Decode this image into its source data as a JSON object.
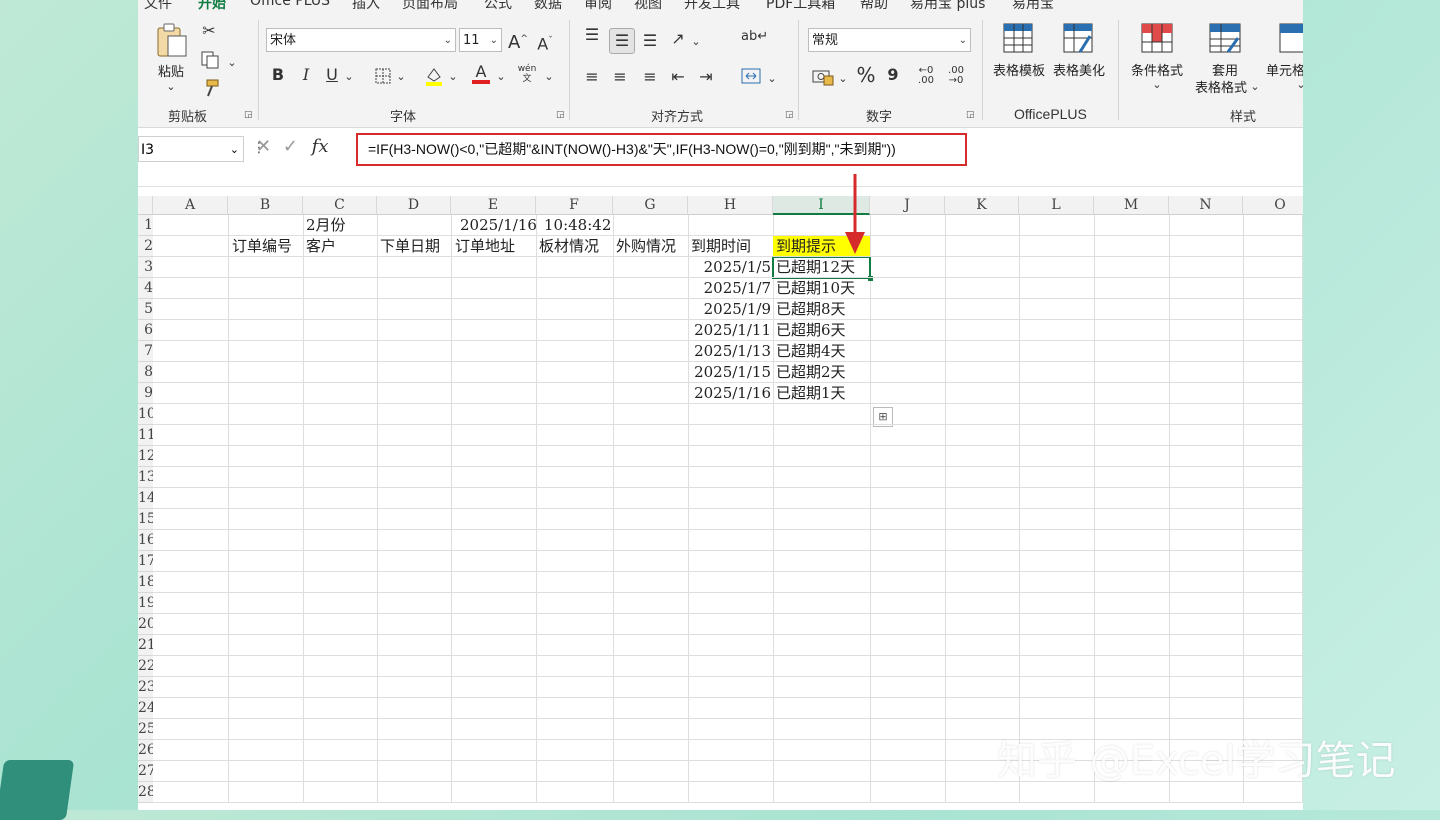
{
  "menu": {
    "items": [
      "文件",
      "开始",
      "Office PLUS",
      "插入",
      "页面布局",
      "公式",
      "数据",
      "审阅",
      "视图",
      "开发工具",
      "PDF工具箱",
      "帮助",
      "易用宝 plus",
      "易用宝"
    ],
    "active_index": 1
  },
  "ribbon": {
    "clipboard": {
      "label": "剪贴板",
      "paste_label": "粘贴"
    },
    "font": {
      "label": "字体",
      "font_name": "宋体",
      "font_size": "11",
      "bold": "B",
      "italic": "I",
      "underline": "U",
      "phonetic": "wén"
    },
    "alignment": {
      "label": "对齐方式"
    },
    "number": {
      "label": "数字",
      "format": "常规",
      "percent": "%",
      "comma": "9",
      "inc_decimal": ".00",
      "dec_decimal": ".00"
    },
    "officeplus": {
      "label": "OfficePLUS",
      "table_template": "表格模板",
      "table_beautify": "表格美化"
    },
    "styles": {
      "label": "样式",
      "conditional": "条件格式",
      "format_table_1": "套用",
      "format_table_2": "表格格式",
      "cell_styles": "单元格"
    }
  },
  "formula_bar": {
    "name_box": "I3",
    "fx": "fx",
    "formula": "=IF(H3-NOW()<0,\"已超期\"&INT(NOW()-H3)&\"天\",IF(H3-NOW()=0,\"刚到期\",\"未到期\"))"
  },
  "sheet": {
    "columns": [
      "A",
      "B",
      "C",
      "D",
      "E",
      "F",
      "G",
      "H",
      "I",
      "J",
      "K",
      "L",
      "M",
      "N",
      "O"
    ],
    "selected_column": "I",
    "row_numbers": [
      "1",
      "2",
      "3",
      "4",
      "5",
      "6",
      "7",
      "8",
      "9",
      "10",
      "11",
      "12",
      "13",
      "14",
      "15",
      "16",
      "17",
      "18",
      "19",
      "20",
      "21",
      "22",
      "23",
      "24",
      "25",
      "26",
      "27",
      "28"
    ],
    "row1": {
      "C": "2月份",
      "E": "2025/1/16",
      "F": "10:48:42"
    },
    "headers": {
      "B": "订单编号",
      "C": "客户",
      "D": "下单日期",
      "E": "订单地址",
      "F": "板材情况",
      "G": "外购情况",
      "H": "到期时间",
      "I": "到期提示"
    },
    "rows": [
      {
        "H": "2025/1/5",
        "I": "已超期12天"
      },
      {
        "H": "2025/1/7",
        "I": "已超期10天"
      },
      {
        "H": "2025/1/9",
        "I": "已超期8天"
      },
      {
        "H": "2025/1/11",
        "I": "已超期6天"
      },
      {
        "H": "2025/1/13",
        "I": "已超期4天"
      },
      {
        "H": "2025/1/15",
        "I": "已超期2天"
      },
      {
        "H": "2025/1/16",
        "I": "已超期1天"
      }
    ]
  },
  "watermark": "知乎 @Excel学习笔记",
  "colors": {
    "accent": "#107c41",
    "highlight": "#ffff00",
    "annotation": "#d62b2b"
  }
}
